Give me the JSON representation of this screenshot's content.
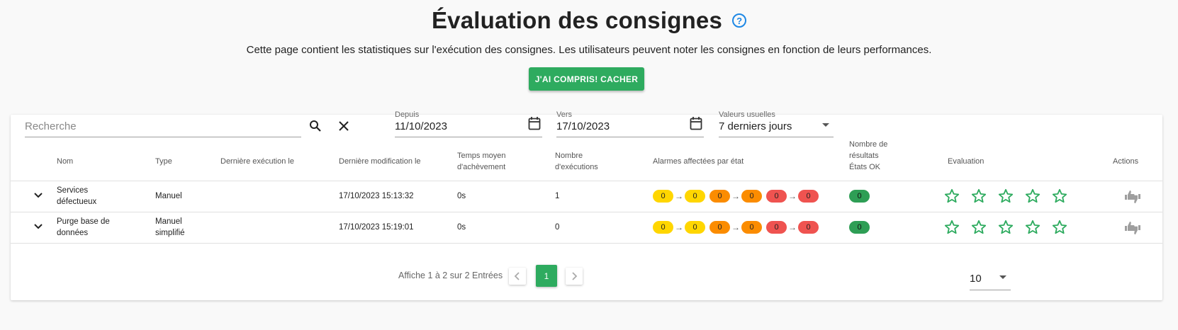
{
  "page": {
    "title": "Évaluation des consignes",
    "description": "Cette page contient les statistiques sur l'exécution des consignes. Les utilisateurs peuvent noter les consignes en fonction de leurs performances.",
    "ack_button": "J'AI COMPRIS! CACHER"
  },
  "filters": {
    "search_placeholder": "Recherche",
    "since_label": "Depuis",
    "since_value": "11/10/2023",
    "to_label": "Vers",
    "to_value": "17/10/2023",
    "preset_label": "Valeurs usuelles",
    "preset_value": "7 derniers jours"
  },
  "table": {
    "headers": {
      "name": "Nom",
      "type": "Type",
      "last_exec": "Dernière exécution le",
      "last_modif": "Dernière modification le",
      "avg_time_1": "Temps moyen",
      "avg_time_2": "d'achèvement",
      "exec_count_1": "Nombre",
      "exec_count_2": "d'exécutions",
      "alarms": "Alarmes affectées par état",
      "ok_results_1": "Nombre de",
      "ok_results_2": "résultats",
      "ok_results_3": "États OK",
      "rating": "Evaluation",
      "actions": "Actions"
    },
    "rows": [
      {
        "name_1": "Services",
        "name_2": "défectueux",
        "type_1": "Manuel",
        "type_2": "",
        "last_exec": "",
        "last_modif": "17/10/2023 15:13:32",
        "avg_time": "0s",
        "exec_count": "1",
        "alarms": [
          "0",
          "0",
          "0",
          "0",
          "0",
          "0"
        ],
        "ok_count": "0",
        "rating": 0
      },
      {
        "name_1": "Purge base de",
        "name_2": "données",
        "type_1": "Manuel",
        "type_2": "simplifié",
        "last_exec": "",
        "last_modif": "17/10/2023 15:19:01",
        "avg_time": "0s",
        "exec_count": "0",
        "alarms": [
          "0",
          "0",
          "0",
          "0",
          "0",
          "0"
        ],
        "ok_count": "0",
        "rating": 0
      }
    ]
  },
  "pagination": {
    "info": "Affiche 1 à 2 sur 2 Entrées",
    "current_page": "1",
    "per_page": "10"
  },
  "colors": {
    "accent": "#2eab5f",
    "help": "#1e88e5",
    "alarm_minor": "#ffd600",
    "alarm_major": "#fb8c00",
    "alarm_critical": "#ef5350",
    "ok": "#2e9e55",
    "star": "#2eab5f"
  }
}
